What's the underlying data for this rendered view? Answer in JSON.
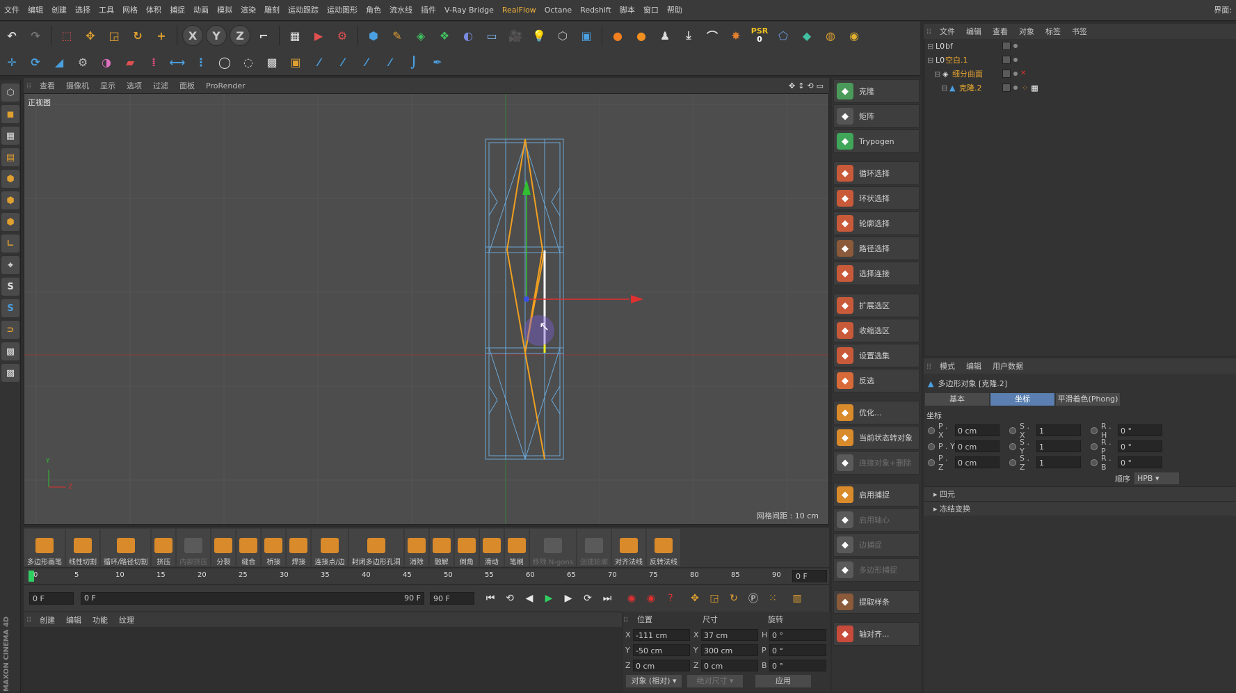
{
  "menubar": {
    "items": [
      "文件",
      "编辑",
      "创建",
      "选择",
      "工具",
      "网格",
      "体积",
      "捕捉",
      "动画",
      "模拟",
      "渲染",
      "雕刻",
      "运动跟踪",
      "运动图形",
      "角色",
      "流水线",
      "插件",
      "V-Ray Bridge",
      "RealFlow",
      "Octane",
      "Redshift",
      "脚本",
      "窗口",
      "帮助"
    ],
    "highlight": "RealFlow",
    "layout_label": "界面:"
  },
  "toolbar1": {
    "axis_x": "X",
    "axis_y": "Y",
    "axis_z": "Z",
    "psr_label": "PSR",
    "psr_value": "0"
  },
  "viewport": {
    "menu": [
      "查看",
      "摄像机",
      "显示",
      "选项",
      "过滤",
      "面板",
      "ProRender"
    ],
    "view_name": "正视图",
    "grid_spacing": "网格间距 : 10 cm",
    "axis_y": "Y",
    "axis_z": "Z"
  },
  "tools_panel": {
    "groups": [
      [
        {
          "label": "克隆",
          "icon_color": "#4a9a5a",
          "disabled": false
        },
        {
          "label": "矩阵",
          "icon_color": "#555555",
          "disabled": false
        },
        {
          "label": "Trypogen",
          "icon_color": "#3fa65a",
          "disabled": false
        }
      ],
      [
        {
          "label": "循环选择",
          "icon_color": "#c85a3a",
          "disabled": false
        },
        {
          "label": "环状选择",
          "icon_color": "#c85a3a",
          "disabled": false
        },
        {
          "label": "轮廓选择",
          "icon_color": "#c85a3a",
          "disabled": false
        },
        {
          "label": "路径选择",
          "icon_color": "#8a5a3a",
          "disabled": false
        },
        {
          "label": "选择连接",
          "icon_color": "#c85a3a",
          "disabled": false
        }
      ],
      [
        {
          "label": "扩展选区",
          "icon_color": "#c85a3a",
          "disabled": false
        },
        {
          "label": "收缩选区",
          "icon_color": "#c85a3a",
          "disabled": false
        },
        {
          "label": "设置选集",
          "icon_color": "#c85a3a",
          "disabled": false
        },
        {
          "label": "反选",
          "icon_color": "#d86a3a",
          "disabled": false
        }
      ],
      [
        {
          "label": "优化...",
          "icon_color": "#d98a2b",
          "disabled": false
        },
        {
          "label": "当前状态转对象",
          "icon_color": "#d98a2b",
          "disabled": false
        },
        {
          "label": "连接对象+删除",
          "icon_color": "#5a5a5a",
          "disabled": true
        }
      ],
      [
        {
          "label": "启用捕捉",
          "icon_color": "#d98a2b",
          "disabled": false
        },
        {
          "label": "启用轴心",
          "icon_color": "#5a5a5a",
          "disabled": true
        },
        {
          "label": "边捕捉",
          "icon_color": "#5a5a5a",
          "disabled": true
        },
        {
          "label": "多边形捕捉",
          "icon_color": "#5a5a5a",
          "disabled": true
        }
      ],
      [
        {
          "label": "提取样条",
          "icon_color": "#8a5a3a",
          "disabled": false
        }
      ],
      [
        {
          "label": "轴对齐...",
          "icon_color": "#c84a3a",
          "disabled": false
        }
      ]
    ]
  },
  "object_manager": {
    "menu": [
      "文件",
      "编辑",
      "查看",
      "对象",
      "标签",
      "书签"
    ],
    "objects": [
      {
        "name": "bf",
        "indent": 0,
        "color": "#c8c8c8"
      },
      {
        "name": "空白.1",
        "indent": 0,
        "color": "#e0a030"
      },
      {
        "name": "细分曲面",
        "indent": 1,
        "color": "#e0a030"
      },
      {
        "name": "克隆.2",
        "indent": 2,
        "color": "#f0b030"
      }
    ]
  },
  "attributes": {
    "menu": [
      "模式",
      "编辑",
      "用户数据"
    ],
    "title": "多边形对象 [克隆.2]",
    "tabs": [
      "基本",
      "坐标",
      "平滑着色(Phong)"
    ],
    "active_tab": 1,
    "section_title": "坐标",
    "rows": [
      [
        {
          "label": "P . X",
          "value": "0 cm"
        },
        {
          "label": "S . X",
          "value": "1"
        },
        {
          "label": "R . H",
          "value": "0 °"
        }
      ],
      [
        {
          "label": "P . Y",
          "value": "0 cm"
        },
        {
          "label": "S . Y",
          "value": "1"
        },
        {
          "label": "R . P",
          "value": "0 °"
        }
      ],
      [
        {
          "label": "P . Z",
          "value": "0 cm"
        },
        {
          "label": "S . Z",
          "value": "1"
        },
        {
          "label": "R . B",
          "value": "0 °"
        }
      ]
    ],
    "order_label": "顺序",
    "order_value": "HPB",
    "collapsed_sections": [
      "四元",
      "冻结变换"
    ]
  },
  "modeling_bar": {
    "buttons": [
      {
        "label": "多边形画笔",
        "disabled": false
      },
      {
        "label": "线性切割",
        "disabled": false
      },
      {
        "label": "循环/路径切割",
        "disabled": false
      },
      {
        "label": "挤压",
        "disabled": false
      },
      {
        "label": "内部挤压",
        "disabled": true
      },
      {
        "label": "分裂",
        "disabled": false
      },
      {
        "label": "缝合",
        "disabled": false
      },
      {
        "label": "桥接",
        "disabled": false
      },
      {
        "label": "焊接",
        "disabled": false
      },
      {
        "label": "连接点/边",
        "disabled": false
      },
      {
        "label": "封闭多边形孔洞",
        "disabled": false
      },
      {
        "label": "消除",
        "disabled": false
      },
      {
        "label": "融解",
        "disabled": false
      },
      {
        "label": "倒角",
        "disabled": false
      },
      {
        "label": "滑动",
        "disabled": false
      },
      {
        "label": "笔刷",
        "disabled": false
      },
      {
        "label": "移除 N-gons",
        "disabled": true
      },
      {
        "label": "创建轮廓",
        "disabled": true
      },
      {
        "label": "对齐法线",
        "disabled": false
      },
      {
        "label": "反转法线",
        "disabled": false
      }
    ]
  },
  "timeline": {
    "ticks": [
      "0",
      "5",
      "10",
      "15",
      "20",
      "25",
      "30",
      "35",
      "40",
      "45",
      "50",
      "55",
      "60",
      "65",
      "70",
      "75",
      "80",
      "85",
      "90"
    ],
    "current_frame": "0 F"
  },
  "playback": {
    "start_frame": "0 F",
    "range_start": "0 F",
    "range_end": "90 F",
    "end_frame": "90 F"
  },
  "material_manager": {
    "menu": [
      "创建",
      "编辑",
      "功能",
      "纹理"
    ]
  },
  "coord_manager": {
    "headers": [
      "位置",
      "尺寸",
      "旋转"
    ],
    "rows": [
      {
        "a": "X",
        "pos": "-111 cm",
        "b": "X",
        "size": "37 cm",
        "c": "H",
        "rot": "0 °"
      },
      {
        "a": "Y",
        "pos": "-50 cm",
        "b": "Y",
        "size": "300 cm",
        "c": "P",
        "rot": "0 °"
      },
      {
        "a": "Z",
        "pos": "0 cm",
        "b": "Z",
        "size": "0 cm",
        "c": "B",
        "rot": "0 °"
      }
    ],
    "mode": "对象 (相对)",
    "size_mode": "绝对尺寸",
    "apply": "应用"
  },
  "branding": "MAXON CINEMA 4D",
  "colors": {
    "accent": "#e0a030",
    "selection_blue": "#5a7fb0",
    "axis_red": "#e03030",
    "axis_green": "#30c030"
  }
}
